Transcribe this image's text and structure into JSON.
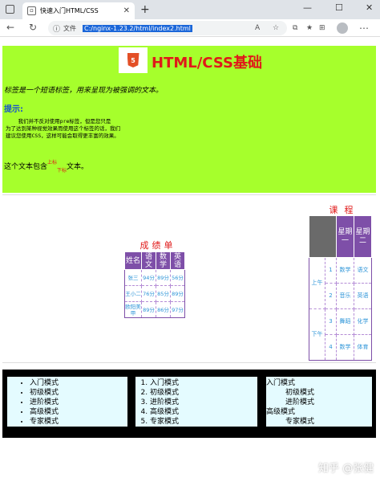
{
  "browser": {
    "tab_title": "快速入门HTML/CSS",
    "tab_close": "✕",
    "new_tab": "+",
    "win_min": "—",
    "win_max": "☐",
    "win_close": "✕",
    "addr_label": "文件",
    "url": "C:/nginx-1.23.2/html/index2.html",
    "btn_read": "A",
    "btn_fav": "☆",
    "btn_split": "⧉",
    "btn_favs": "★",
    "btn_coll": "⊞",
    "btn_more": "⋯"
  },
  "header": {
    "logo_text": "5",
    "title": "HTML/CSS基础",
    "subtitle": "标签是一个短语标签，用来呈现为被强调的文本。",
    "tip_heading": "提示:",
    "pre_text": "    我们并不反对使用pre标签，但是您只是\n为了达到某种视觉效果而使用这个标签的话，我们\n建议您使用CSS，这样可能会取得更丰富的效果。",
    "inline_before": "这个文本包含",
    "sup_text": "上标",
    "sub_text": "下标",
    "inline_after": "文本。"
  },
  "score_table": {
    "caption": "成绩单",
    "headers": [
      "姓名",
      "语文",
      "数学",
      "英语"
    ],
    "rows": [
      [
        "张三",
        "94分",
        "89分",
        "56分"
      ],
      [
        "王小二",
        "76分",
        "85分",
        "89分"
      ],
      [
        "欧阳美甲",
        "89分",
        "86分",
        "97分"
      ]
    ]
  },
  "course_table": {
    "caption": "课程",
    "headers": [
      "星期一",
      "星期二"
    ],
    "groups": [
      {
        "label": "上午",
        "rows": [
          [
            "1",
            "数学",
            "语文"
          ],
          [
            "2",
            "音乐",
            "英语"
          ]
        ]
      },
      {
        "label": "下午",
        "rows": [
          [
            "3",
            "舞蹈",
            "化学"
          ],
          [
            "4",
            "数学",
            "体育"
          ]
        ]
      }
    ]
  },
  "lists": {
    "ul": [
      "入门模式",
      "初级模式",
      "进阶模式",
      "高级模式",
      "专家模式"
    ],
    "ol": [
      "入门模式",
      "初级模式",
      "进阶模式",
      "高级模式",
      "专家模式"
    ],
    "dl": [
      {
        "dt": "入门模式",
        "dd": [
          "初级模式",
          "进阶模式"
        ]
      },
      {
        "dt": "高级模式",
        "dd": [
          "专家模式"
        ]
      }
    ]
  },
  "watermark": "知乎 @张健",
  "colors": {
    "header_bg": "#a6ff2c",
    "title": "#e01919",
    "table_header": "#7e4fa8",
    "cell_text": "#2e95d8",
    "list_bg": "#e4fbff"
  }
}
